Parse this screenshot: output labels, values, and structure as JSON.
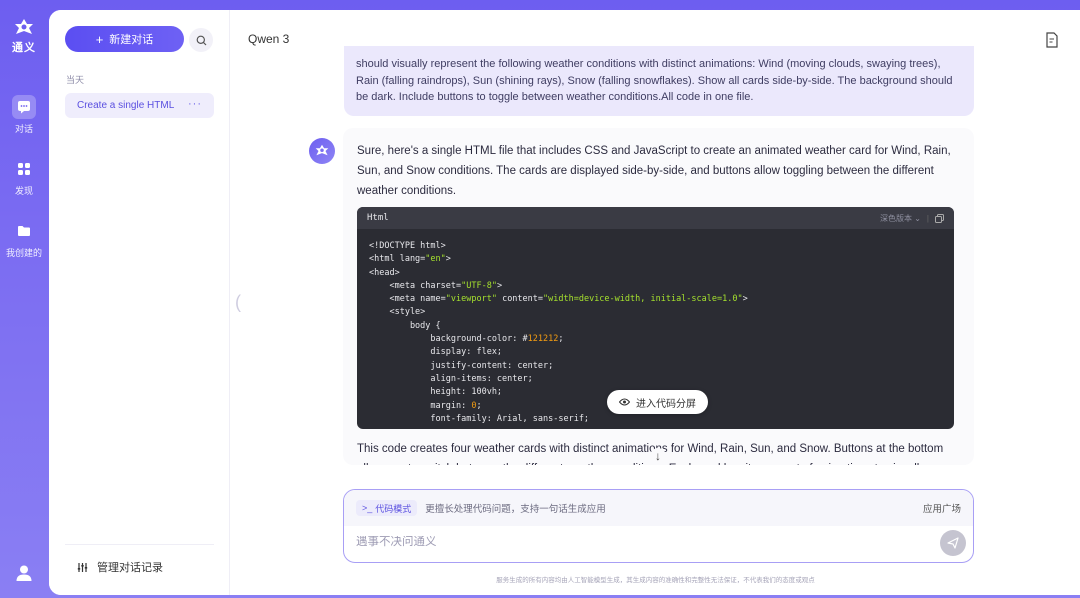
{
  "rail": {
    "logo_text": "通义",
    "items": [
      {
        "label": "对话",
        "icon": "chat-icon",
        "active": true
      },
      {
        "label": "发现",
        "icon": "grid-icon",
        "active": false
      },
      {
        "label": "我创建的",
        "icon": "folder-icon",
        "active": false
      }
    ]
  },
  "sidebar": {
    "new_chat_label": "新建对话",
    "section_today": "当天",
    "conversations": [
      {
        "title": "Create a single HTML",
        "more": "···"
      }
    ],
    "manage_label": "管理对话记录"
  },
  "header": {
    "model": "Qwen 3"
  },
  "chat": {
    "user_message": "should visually represent the following weather conditions with distinct animations: Wind (moving clouds, swaying trees), Rain (falling raindrops), Sun (shining rays), Snow (falling snowflakes). Show all cards side-by-side. The background should be dark. Include buttons to toggle between weather conditions.All code in one file.",
    "assistant_intro": "Sure, here's a single HTML file that includes CSS and JavaScript to create an animated weather card for Wind, Rain, Sun, and Snow conditions. The cards are displayed side-by-side, and buttons allow toggling between the different weather conditions.",
    "code": {
      "language": "Html",
      "theme_label": "深色版本",
      "split_label": "进入代码分屏"
    },
    "assistant_outro": "This code creates four weather cards with distinct animations for Wind, Rain, Sun, and Snow. Buttons at the bottom allow you to switch between the different weather conditions. Each card has its own set of animations to visually"
  },
  "composer": {
    "mode_label": "代码模式",
    "mode_hint": "更擅长处理代码问题，支持一句话生成应用",
    "app_square": "应用广场",
    "placeholder": "遇事不决问通义"
  },
  "disclaimer": "服务生成的所有内容均由人工智能模型生成，其生成内容的准确性和完整性无法保证，不代表我们的态度或观点",
  "colors": {
    "accent": "#5b4ef2",
    "user_bubble": "#ebe8fc",
    "code_bg": "#2b2c33"
  }
}
